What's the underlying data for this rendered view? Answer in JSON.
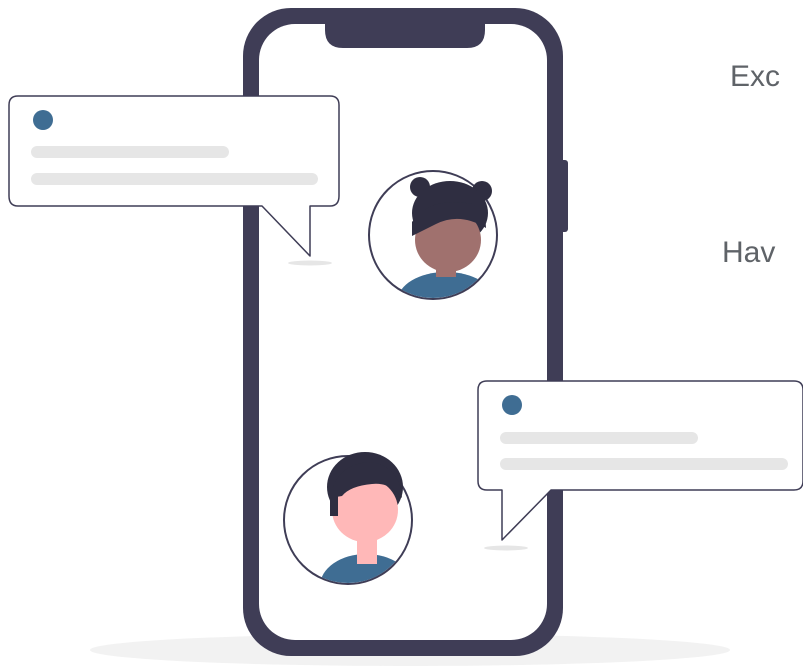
{
  "texts": {
    "line1": "Exc",
    "line2": "Hav"
  },
  "colors": {
    "phone_frame": "#3f3d56",
    "screen": "#ffffff",
    "accent_blue": "#3f6d93",
    "skin_dark": "#a0716e",
    "skin_light": "#ffb8b8",
    "hair": "#2f2e41",
    "placeholder_line": "#e6e6e6",
    "floor_shadow": "#f2f2f2"
  },
  "icons": [
    "chat-bubble-icon",
    "avatar-icon",
    "phone-icon"
  ]
}
